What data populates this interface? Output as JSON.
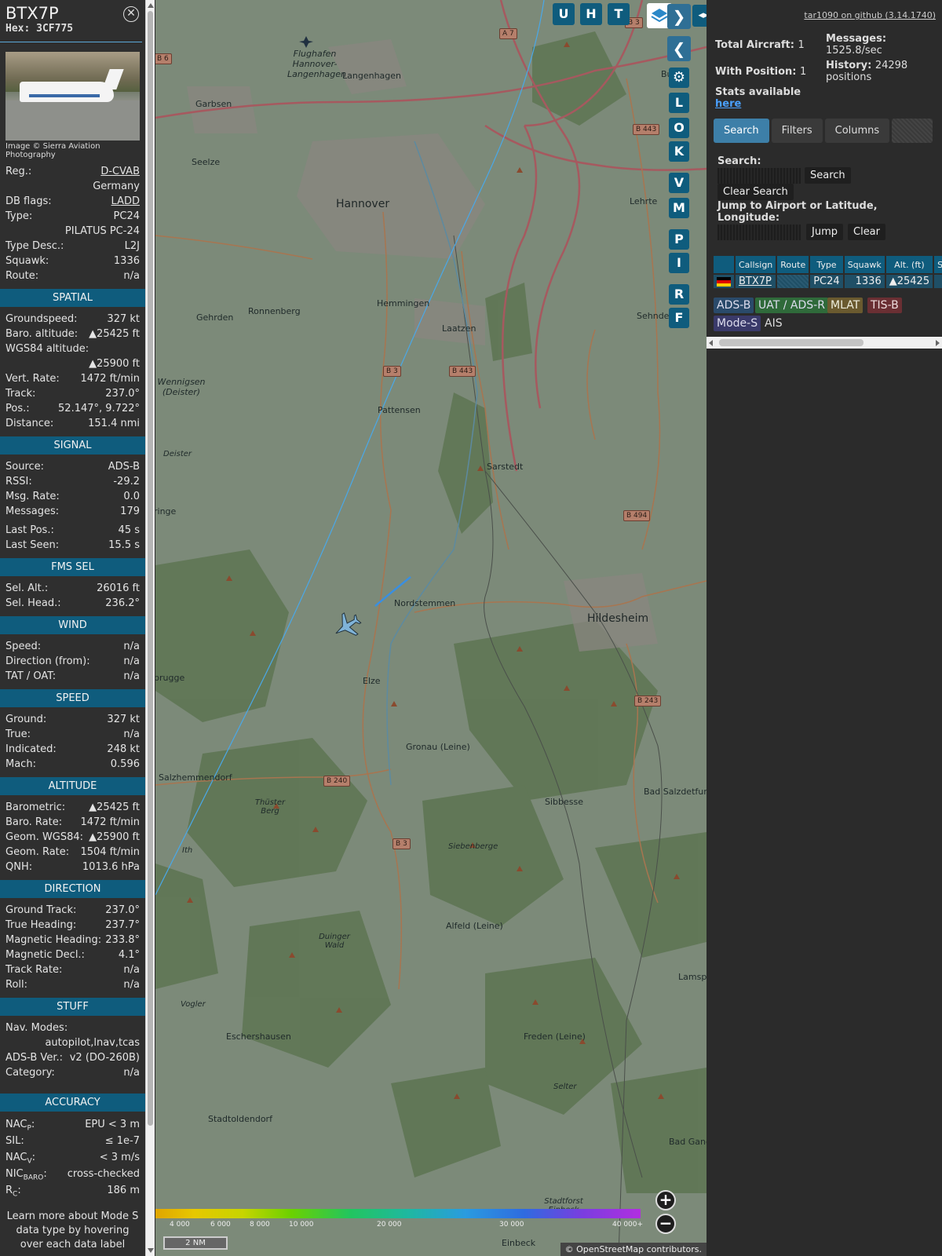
{
  "aircraft": {
    "callsign": "BTX7P",
    "hex_label": "Hex:",
    "hex": "3CF775",
    "photo_credit": "Image © Sierra Aviation Photography"
  },
  "details": [
    {
      "k": "Reg.:",
      "v": "D-CVAB",
      "link": true
    },
    {
      "k": "",
      "v": "Germany"
    },
    {
      "k": "DB flags:",
      "v": "LADD",
      "link": true
    },
    {
      "k": "Type:",
      "v": "PC24"
    },
    {
      "k": "",
      "v": "PILATUS PC-24"
    },
    {
      "k": "Type Desc.:",
      "v": "L2J"
    },
    {
      "k": "Squawk:",
      "v": "1336"
    },
    {
      "k": "Route:",
      "v": "n/a"
    }
  ],
  "sections": [
    {
      "title": "SPATIAL",
      "rows": [
        {
          "k": "Groundspeed:",
          "v": "327 kt"
        },
        {
          "k": "Baro. altitude:",
          "v": "▲25425 ft"
        },
        {
          "k": "WGS84 altitude:",
          "v": ""
        },
        {
          "k": "",
          "v": "▲25900 ft"
        },
        {
          "k": "Vert. Rate:",
          "v": "1472 ft/min"
        },
        {
          "k": "Track:",
          "v": "237.0°"
        },
        {
          "k": "Pos.:",
          "v": "52.147°, 9.722°"
        },
        {
          "k": "Distance:",
          "v": "151.4 nmi"
        }
      ]
    },
    {
      "title": "SIGNAL",
      "rows": [
        {
          "k": "Source:",
          "v": "ADS-B"
        },
        {
          "k": "RSSI:",
          "v": "-29.2"
        },
        {
          "k": "Msg. Rate:",
          "v": "0.0"
        },
        {
          "k": "Messages:",
          "v": "179"
        },
        {
          "gap": true
        },
        {
          "k": "Last Pos.:",
          "v": "45 s"
        },
        {
          "k": "Last Seen:",
          "v": "15.5 s"
        }
      ]
    },
    {
      "title": "FMS SEL",
      "rows": [
        {
          "k": "Sel. Alt.:",
          "v": "26016 ft"
        },
        {
          "k": "Sel. Head.:",
          "v": "236.2°"
        }
      ]
    },
    {
      "title": "WIND",
      "rows": [
        {
          "k": "Speed:",
          "v": "n/a"
        },
        {
          "k": "Direction (from):",
          "v": "n/a"
        },
        {
          "k": "TAT / OAT:",
          "v": "n/a"
        }
      ]
    },
    {
      "title": "SPEED",
      "rows": [
        {
          "k": "Ground:",
          "v": "327 kt"
        },
        {
          "k": "True:",
          "v": "n/a"
        },
        {
          "k": "Indicated:",
          "v": "248 kt"
        },
        {
          "k": "Mach:",
          "v": "0.596"
        }
      ]
    },
    {
      "title": "ALTITUDE",
      "rows": [
        {
          "k": "Barometric:",
          "v": "▲25425 ft"
        },
        {
          "k": "Baro. Rate:",
          "v": "1472 ft/min"
        },
        {
          "k": "Geom. WGS84:",
          "v": "▲25900 ft"
        },
        {
          "k": "Geom. Rate:",
          "v": "1504 ft/min"
        },
        {
          "k": "QNH:",
          "v": "1013.6 hPa"
        }
      ]
    },
    {
      "title": "DIRECTION",
      "rows": [
        {
          "k": "Ground Track:",
          "v": "237.0°"
        },
        {
          "k": "True Heading:",
          "v": "237.7°"
        },
        {
          "k": "Magnetic Heading:",
          "v": "233.8°"
        },
        {
          "k": "Magnetic Decl.:",
          "v": "4.1°"
        },
        {
          "k": "Track Rate:",
          "v": "n/a"
        },
        {
          "k": "Roll:",
          "v": "n/a"
        }
      ]
    },
    {
      "title": "STUFF",
      "rows": [
        {
          "k": "Nav. Modes:",
          "v": ""
        },
        {
          "k": "",
          "v": "autopilot,lnav,tcas"
        },
        {
          "k": "ADS-B Ver.:",
          "v": "v2 (DO-260B)"
        },
        {
          "k": "Category:",
          "v": "n/a"
        },
        {
          "gap": true
        },
        {
          "gap": true
        }
      ]
    }
  ],
  "accuracy": {
    "title": "ACCURACY",
    "rows": [
      {
        "k": "NAC",
        "sub": "P",
        "v": "EPU < 3 m"
      },
      {
        "k": "SIL:",
        "sub": "",
        "v": "≤ 1e-7"
      },
      {
        "k": "NAC",
        "sub": "V",
        "v": "< 3 m/s"
      },
      {
        "k": "NIC",
        "sub": "BARO",
        "v": "cross-checked"
      },
      {
        "k": "R",
        "sub": "C",
        "v": "186 m"
      }
    ],
    "more": "Learn more about Mode S data type by hovering over each data label"
  },
  "map": {
    "top_buttons": [
      "U",
      "H",
      "T"
    ],
    "side_buttons": [
      "L",
      "O",
      "K",
      "V",
      "M",
      "P",
      "I",
      "R",
      "F"
    ],
    "cities": [
      {
        "name": "Hannover",
        "big": true
      },
      {
        "name": "Langenhagen"
      },
      {
        "name": "Garbsen"
      },
      {
        "name": "Seelze"
      },
      {
        "name": "Flughafen Hannover-Langenhagen"
      },
      {
        "name": "Lehrte"
      },
      {
        "name": "Burg"
      },
      {
        "name": "Hemmingen"
      },
      {
        "name": "Ronnenberg"
      },
      {
        "name": "Gehrden"
      },
      {
        "name": "Laatzen"
      },
      {
        "name": "Sehnde"
      },
      {
        "name": "Wennigsen (Deister)"
      },
      {
        "name": "Pattensen"
      },
      {
        "name": "Sarstedt"
      },
      {
        "name": "Deister"
      },
      {
        "name": "ringe"
      },
      {
        "name": "Nordstemmen"
      },
      {
        "name": "Hildesheim",
        "big": true
      },
      {
        "name": "brugge"
      },
      {
        "name": "Elze"
      },
      {
        "name": "Gronau (Leine)"
      },
      {
        "name": "Salzhemmendorf"
      },
      {
        "name": "Thüster Berg"
      },
      {
        "name": "Sibbesse"
      },
      {
        "name": "Bad Salzdetfurt"
      },
      {
        "name": "Siebenberge"
      },
      {
        "name": "Ith"
      },
      {
        "name": "Alfeld (Leine)"
      },
      {
        "name": "Duinger Wald"
      },
      {
        "name": "Lamspringe"
      },
      {
        "name": "Vogler"
      },
      {
        "name": "Eschershausen"
      },
      {
        "name": "Freden (Leine)"
      },
      {
        "name": "Selter"
      },
      {
        "name": "Stadtoldendorf"
      },
      {
        "name": "Bad Gand"
      },
      {
        "name": "Stadtforst Einbeck"
      },
      {
        "name": "Einbeck"
      }
    ],
    "roads": [
      "A 7",
      "B 3",
      "B 6",
      "B 443",
      "B 443",
      "B 3",
      "B 494",
      "B 243",
      "B 240",
      "B 3"
    ],
    "altitude_scale": [
      "4 000",
      "6 000",
      "8 000",
      "10 000",
      "20 000",
      "30 000",
      "40 000+"
    ],
    "scale": "2 NM",
    "attribution": "© OpenStreetMap contributors."
  },
  "right": {
    "github": "tar1090 on github (3.14.1740)",
    "total_label": "Total Aircraft:",
    "total": "1",
    "withpos_label": "With Position:",
    "withpos": "1",
    "stats_label": "Stats available",
    "stats_link": "here",
    "messages_label": "Messages:",
    "messages": "1525.8/sec",
    "history_label": "History:",
    "history": "24298 positions",
    "tabs": [
      "Search",
      "Filters",
      "Columns"
    ],
    "search_label": "Search:",
    "search_button": "Search",
    "clear_search": "Clear Search",
    "jump_label": "Jump to Airport or Latitude, Longitude:",
    "jump_button": "Jump",
    "clear_button": "Clear",
    "columns": [
      "",
      "Callsign",
      "Route",
      "Type",
      "Squawk",
      "Alt. (ft)",
      "Spd"
    ],
    "rows": [
      {
        "callsign": "BTX7P",
        "route": "",
        "type": "PC24",
        "squawk": "1336",
        "alt": "▲25425",
        "spd": ""
      }
    ],
    "sources": [
      {
        "name": "ADS-B",
        "bg": "#2a4a6a",
        "fg": "#dde"
      },
      {
        "name": "UAT / ADS-R",
        "bg": "#2f6a3a",
        "fg": "#dde"
      },
      {
        "name": "MLAT",
        "bg": "#6a5a2f",
        "fg": "#eed"
      },
      {
        "name": "TIS-B",
        "bg": "#6a2f33",
        "fg": "#edd"
      },
      {
        "name": "Mode-S",
        "bg": "#3a3a6a",
        "fg": "#dde"
      },
      {
        "name": "AIS",
        "bg": "#2b2b2b",
        "fg": "#ddd"
      }
    ]
  }
}
